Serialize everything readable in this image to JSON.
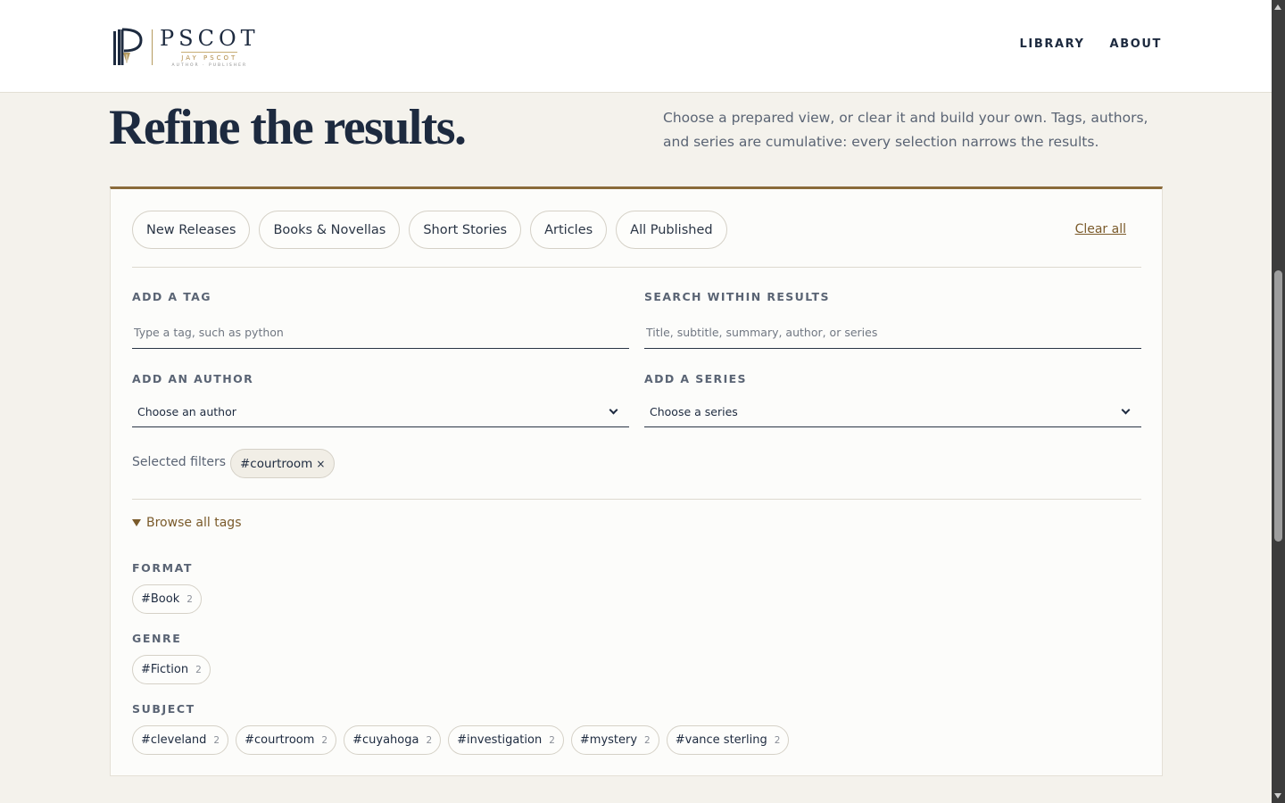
{
  "brand": {
    "name": "PSCOT",
    "tagline": "JAY PSCOT",
    "subtagline": "AUTHOR · PUBLISHER"
  },
  "nav": {
    "items": [
      "LIBRARY",
      "ABOUT"
    ]
  },
  "heading": {
    "title": "Refine the results.",
    "intro": "Choose a prepared view, or clear it and build your own. Tags, authors, and series are cumulative: every selection narrows the results."
  },
  "presets": {
    "items": [
      "New Releases",
      "Books & Novellas",
      "Short Stories",
      "Articles",
      "All Published"
    ],
    "clear_label": "Clear all"
  },
  "filters": {
    "tag_label": "ADD A TAG",
    "tag_placeholder": "Type a tag, such as python",
    "search_label": "SEARCH WITHIN RESULTS",
    "search_placeholder": "Title, subtitle, summary, author, or series",
    "author_label": "ADD AN AUTHOR",
    "author_value": "Choose an author",
    "series_label": "ADD A SERIES",
    "series_value": "Choose a series"
  },
  "selected": {
    "label": "Selected filters",
    "chips": [
      {
        "label": "#courtroom",
        "remove": "×"
      }
    ]
  },
  "browse": {
    "toggle_label": "Browse all tags",
    "groups": [
      {
        "label": "FORMAT",
        "tags": [
          {
            "name": "#Book",
            "count": "2"
          }
        ]
      },
      {
        "label": "GENRE",
        "tags": [
          {
            "name": "#Fiction",
            "count": "2"
          }
        ]
      },
      {
        "label": "SUBJECT",
        "tags": [
          {
            "name": "#cleveland",
            "count": "2"
          },
          {
            "name": "#courtroom",
            "count": "2"
          },
          {
            "name": "#cuyahoga",
            "count": "2"
          },
          {
            "name": "#investigation",
            "count": "2"
          },
          {
            "name": "#mystery",
            "count": "2"
          },
          {
            "name": "#vance sterling",
            "count": "2"
          }
        ]
      }
    ]
  },
  "colors": {
    "navy": "#1d2a3f",
    "gold": "#8a6b3a",
    "background": "#f4f2ec"
  }
}
